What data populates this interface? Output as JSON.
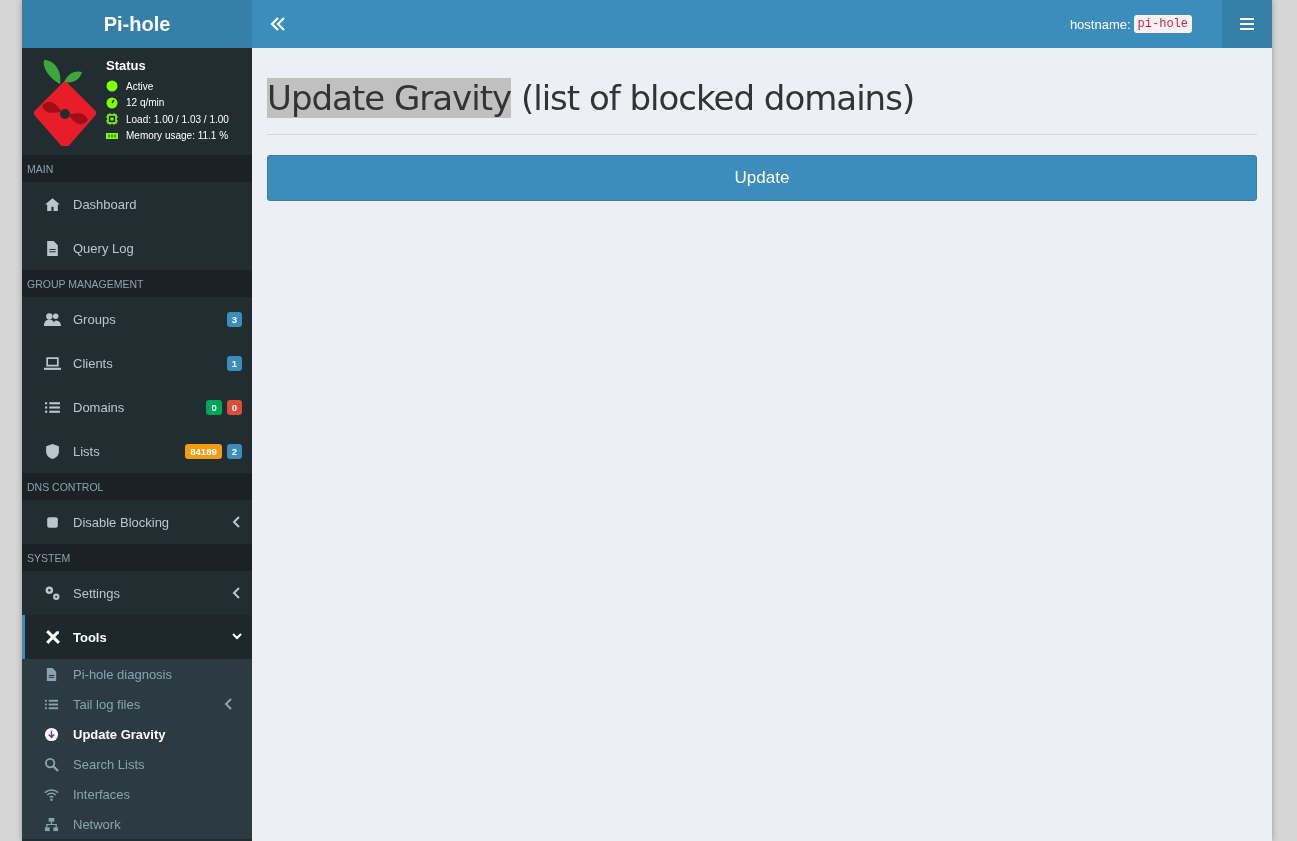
{
  "brand": "Pi-hole",
  "status": {
    "title": "Status",
    "lines": [
      {
        "kind": "active",
        "text": "Active"
      },
      {
        "kind": "rate",
        "text": "12 q/min"
      },
      {
        "kind": "load",
        "text": "Load: 1.00 / 1.03 / 1.00"
      },
      {
        "kind": "memory",
        "text": "Memory usage: 11.1 %"
      }
    ]
  },
  "sections": [
    {
      "header": "MAIN",
      "items": [
        {
          "label": "Dashboard"
        },
        {
          "label": "Query Log"
        }
      ]
    },
    {
      "header": "GROUP MANAGEMENT",
      "items": [
        {
          "label": "Groups",
          "badges": [
            {
              "text": "3",
              "color": "#3c8dbc"
            }
          ]
        },
        {
          "label": "Clients",
          "badges": [
            {
              "text": "1",
              "color": "#3c8dbc"
            }
          ]
        },
        {
          "label": "Domains",
          "badges": [
            {
              "text": "0",
              "color": "#00a65a"
            },
            {
              "text": "0",
              "color": "#dd4b39"
            }
          ]
        },
        {
          "label": "Lists",
          "badges": [
            {
              "text": "84189",
              "color": "#f39c12"
            },
            {
              "text": "2",
              "color": "#3c8dbc"
            }
          ]
        }
      ]
    },
    {
      "header": "DNS CONTROL",
      "items": [
        {
          "label": "Disable Blocking",
          "expanded": false
        }
      ]
    },
    {
      "header": "SYSTEM",
      "items": [
        {
          "label": "Settings",
          "expanded": false
        },
        {
          "label": "Tools",
          "expanded": true,
          "children": [
            {
              "label": "Pi-hole diagnosis",
              "selected": false
            },
            {
              "label": "Tail log files",
              "selected": false,
              "expanded": false
            },
            {
              "label": "Update Gravity",
              "selected": true
            },
            {
              "label": "Search Lists",
              "selected": false
            },
            {
              "label": "Interfaces",
              "selected": false
            },
            {
              "label": "Network",
              "selected": false
            }
          ]
        }
      ]
    }
  ],
  "topbar": {
    "hostname_label": "hostname:",
    "hostname": "pi-hole"
  },
  "page": {
    "title_selected": "Update Gravity",
    "title_rest": "(list of blocked domains)",
    "button": "Update"
  }
}
